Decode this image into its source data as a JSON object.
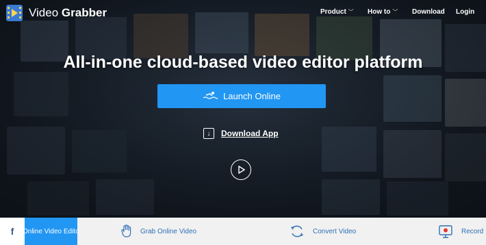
{
  "brand": {
    "name_part1": "Video",
    "name_part2": "Grabber"
  },
  "nav": [
    {
      "label": "Product",
      "has_dropdown": true
    },
    {
      "label": "How to",
      "has_dropdown": true
    },
    {
      "label": "Download",
      "has_dropdown": false
    },
    {
      "label": "Login",
      "has_dropdown": false
    }
  ],
  "hero": {
    "headline": "All-in-one cloud-based video editor platform",
    "launch_label": "Launch Online",
    "download_label": "Download App"
  },
  "tabs": {
    "facebook": "f",
    "active": "Online Video Editor",
    "items": [
      {
        "label": "Grab Online Video",
        "icon": "hand-icon"
      },
      {
        "label": "Convert Video",
        "icon": "refresh-icon"
      },
      {
        "label": "Record",
        "icon": "recorder-icon"
      }
    ]
  },
  "colors": {
    "accent": "#2196f3",
    "tab_text": "#2f6fb5",
    "tab_bar": "#f1f1f1"
  }
}
